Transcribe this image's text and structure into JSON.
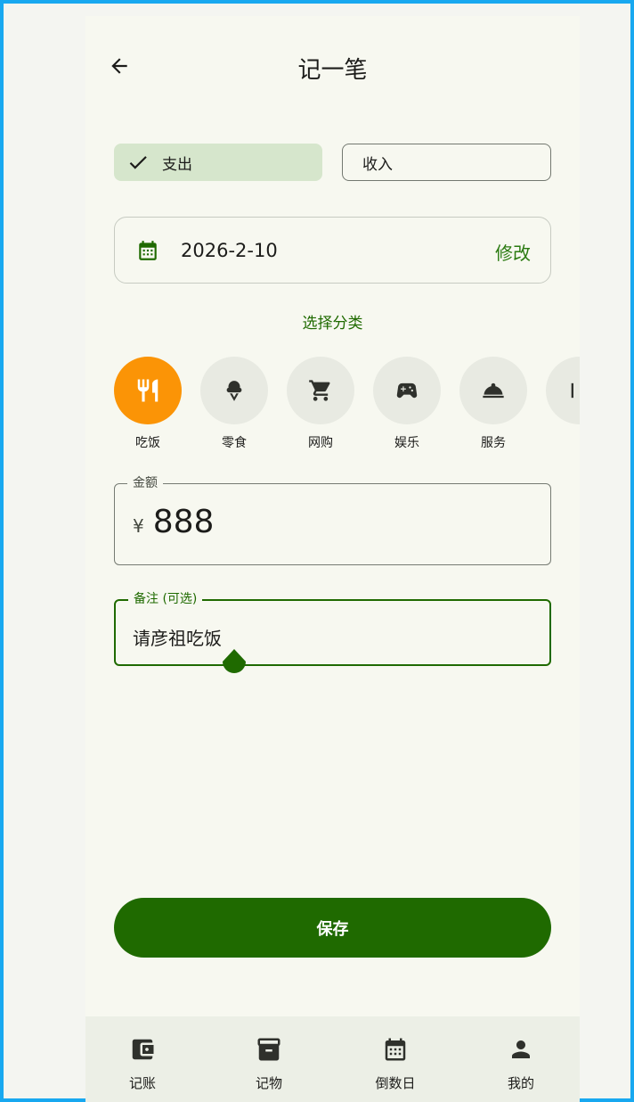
{
  "header": {
    "title": "记一笔",
    "back_icon": "arrow-left-icon"
  },
  "type_toggle": {
    "expense_label": "支出",
    "income_label": "收入",
    "selected": "expense"
  },
  "date": {
    "value": "2026-2-10",
    "edit_label": "修改",
    "icon": "calendar-icon"
  },
  "category": {
    "title": "选择分类",
    "items": [
      {
        "label": "吃饭",
        "icon": "restaurant-icon",
        "active": true
      },
      {
        "label": "零食",
        "icon": "ice-cream-icon",
        "active": false
      },
      {
        "label": "网购",
        "icon": "shopping-cart-icon",
        "active": false
      },
      {
        "label": "娱乐",
        "icon": "gamepad-icon",
        "active": false
      },
      {
        "label": "服务",
        "icon": "room-service-icon",
        "active": false
      }
    ]
  },
  "amount": {
    "label": "金额",
    "currency": "¥",
    "value": "888"
  },
  "note": {
    "label": "备注 (可选)",
    "value": "请彦祖吃饭"
  },
  "save_label": "保存",
  "nav": [
    {
      "label": "记账",
      "icon": "wallet-icon"
    },
    {
      "label": "记物",
      "icon": "archive-icon"
    },
    {
      "label": "倒数日",
      "icon": "calendar-icon"
    },
    {
      "label": "我的",
      "icon": "person-icon"
    }
  ],
  "colors": {
    "primary": "#1f6a00",
    "accent_orange": "#fb9406",
    "selected_chip": "#d6e6cc",
    "background": "#f7f8f0"
  }
}
